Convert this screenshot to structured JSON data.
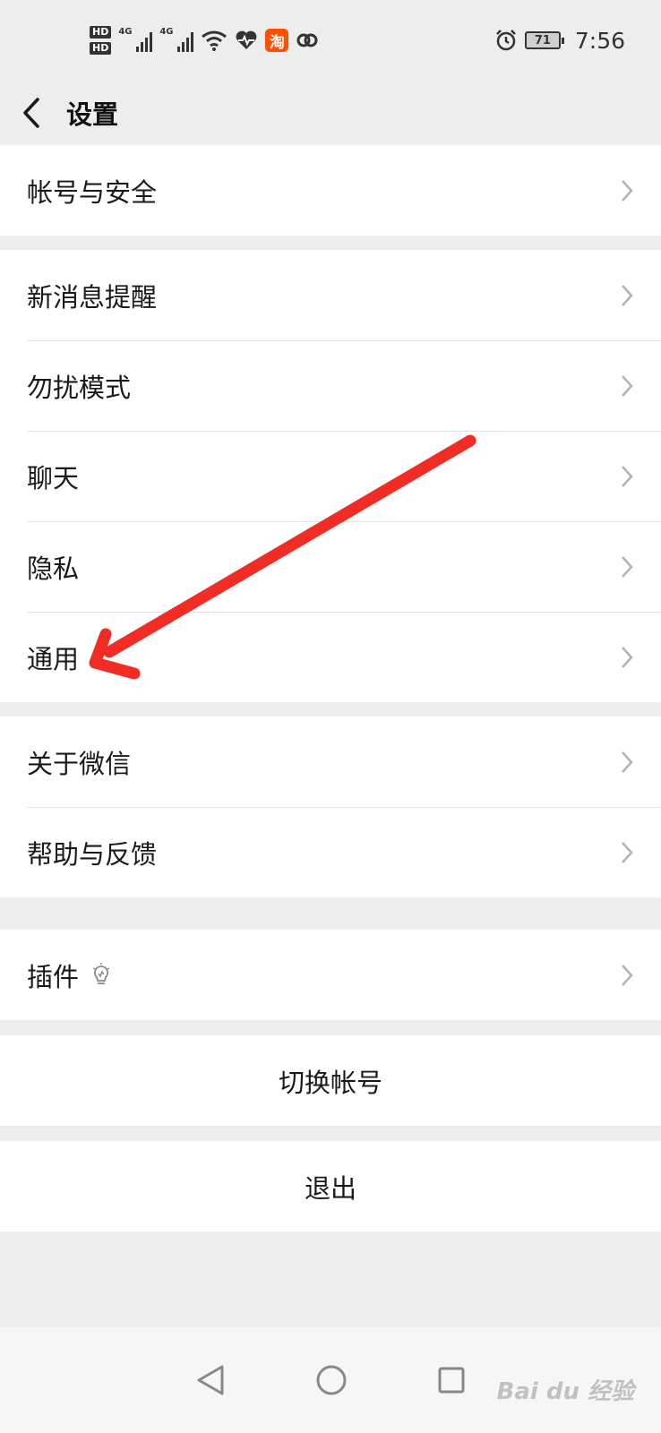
{
  "status_bar": {
    "hd1": "HD",
    "hd2": "HD",
    "net1": "4G",
    "net2": "4G",
    "taobao_glyph": "淘",
    "battery": "71",
    "time": "7:56"
  },
  "nav": {
    "title": "设置"
  },
  "groups": {
    "account": {
      "label": "帐号与安全"
    },
    "notifications": {
      "label": "新消息提醒"
    },
    "dnd": {
      "label": "勿扰模式"
    },
    "chat": {
      "label": "聊天"
    },
    "privacy": {
      "label": "隐私"
    },
    "general": {
      "label": "通用"
    },
    "about": {
      "label": "关于微信"
    },
    "help": {
      "label": "帮助与反馈"
    },
    "plugins": {
      "label": "插件"
    },
    "switch_account": {
      "label": "切换帐号"
    },
    "logout": {
      "label": "退出"
    }
  },
  "watermark": "Bai du 经验",
  "colors": {
    "background": "#ededed",
    "row_background": "#ffffff",
    "annotation_arrow": "#f02c24",
    "text": "#1a1a1a"
  },
  "icons": [
    "back-arrow-icon",
    "chevron-right-icon",
    "lightbulb-icon",
    "wifi-icon",
    "heart-rate-icon",
    "taobao-icon",
    "alarm-icon",
    "battery-icon",
    "nav-back-icon",
    "nav-home-icon",
    "nav-recents-icon"
  ]
}
